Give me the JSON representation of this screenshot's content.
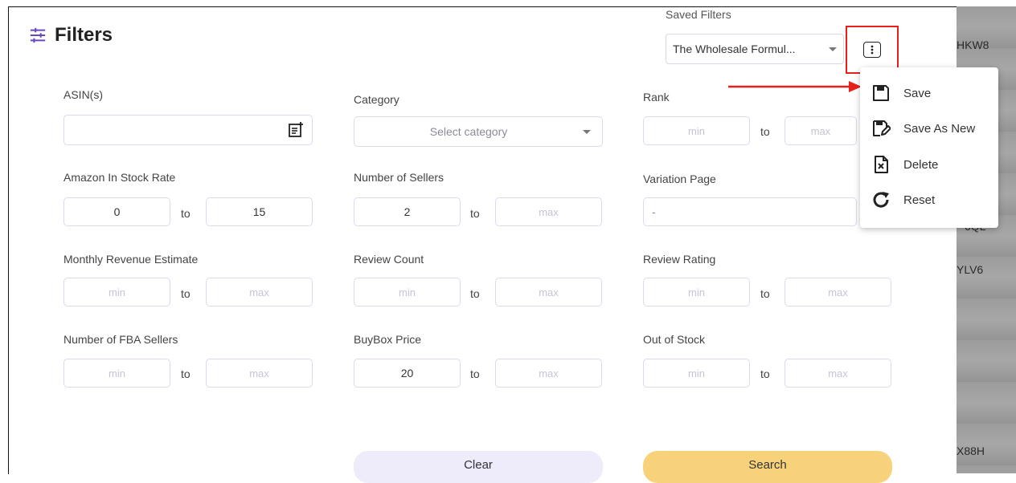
{
  "header": {
    "title": "Filters"
  },
  "saved_filters": {
    "label": "Saved Filters",
    "selected": "The Wholesale Formul..."
  },
  "menu": {
    "items": [
      {
        "label": "Save",
        "icon": "save-icon"
      },
      {
        "label": "Save As New",
        "icon": "save-as-new-icon"
      },
      {
        "label": "Delete",
        "icon": "delete-file-icon"
      },
      {
        "label": "Reset",
        "icon": "reset-icon"
      }
    ]
  },
  "fields": {
    "asin": {
      "label": "ASIN(s)"
    },
    "category": {
      "label": "Category",
      "placeholder": "Select category"
    },
    "rank": {
      "label": "Rank",
      "min_placeholder": "min",
      "max_placeholder": "max"
    },
    "in_stock_rate": {
      "label": "Amazon In Stock Rate",
      "min": "0",
      "max": "15"
    },
    "num_sellers": {
      "label": "Number of Sellers",
      "min": "2",
      "max_placeholder": "max"
    },
    "variation_page": {
      "label": "Variation Page",
      "value": "-"
    },
    "monthly_revenue": {
      "label": "Monthly Revenue Estimate",
      "min_placeholder": "min",
      "max_placeholder": "max"
    },
    "review_count": {
      "label": "Review Count",
      "min_placeholder": "min",
      "max_placeholder": "max"
    },
    "review_rating": {
      "label": "Review Rating",
      "min_placeholder": "min",
      "max_placeholder": "max"
    },
    "fba_sellers": {
      "label": "Number of FBA Sellers",
      "min_placeholder": "min",
      "max_placeholder": "max"
    },
    "buybox_price": {
      "label": "BuyBox Price",
      "min": "20",
      "max_placeholder": "max"
    },
    "out_of_stock": {
      "label": "Out of Stock",
      "min_placeholder": "min",
      "max_placeholder": "max"
    },
    "to_label": "to"
  },
  "buttons": {
    "clear": "Clear",
    "search": "Search"
  },
  "background": {
    "codes": [
      "HKW8",
      "6QL",
      "YLV6",
      "X88H"
    ]
  },
  "colors": {
    "accent": "#6b46c1",
    "search_button": "#f7d27a",
    "clear_button": "#eeebfa",
    "highlight": "#e8201c"
  }
}
